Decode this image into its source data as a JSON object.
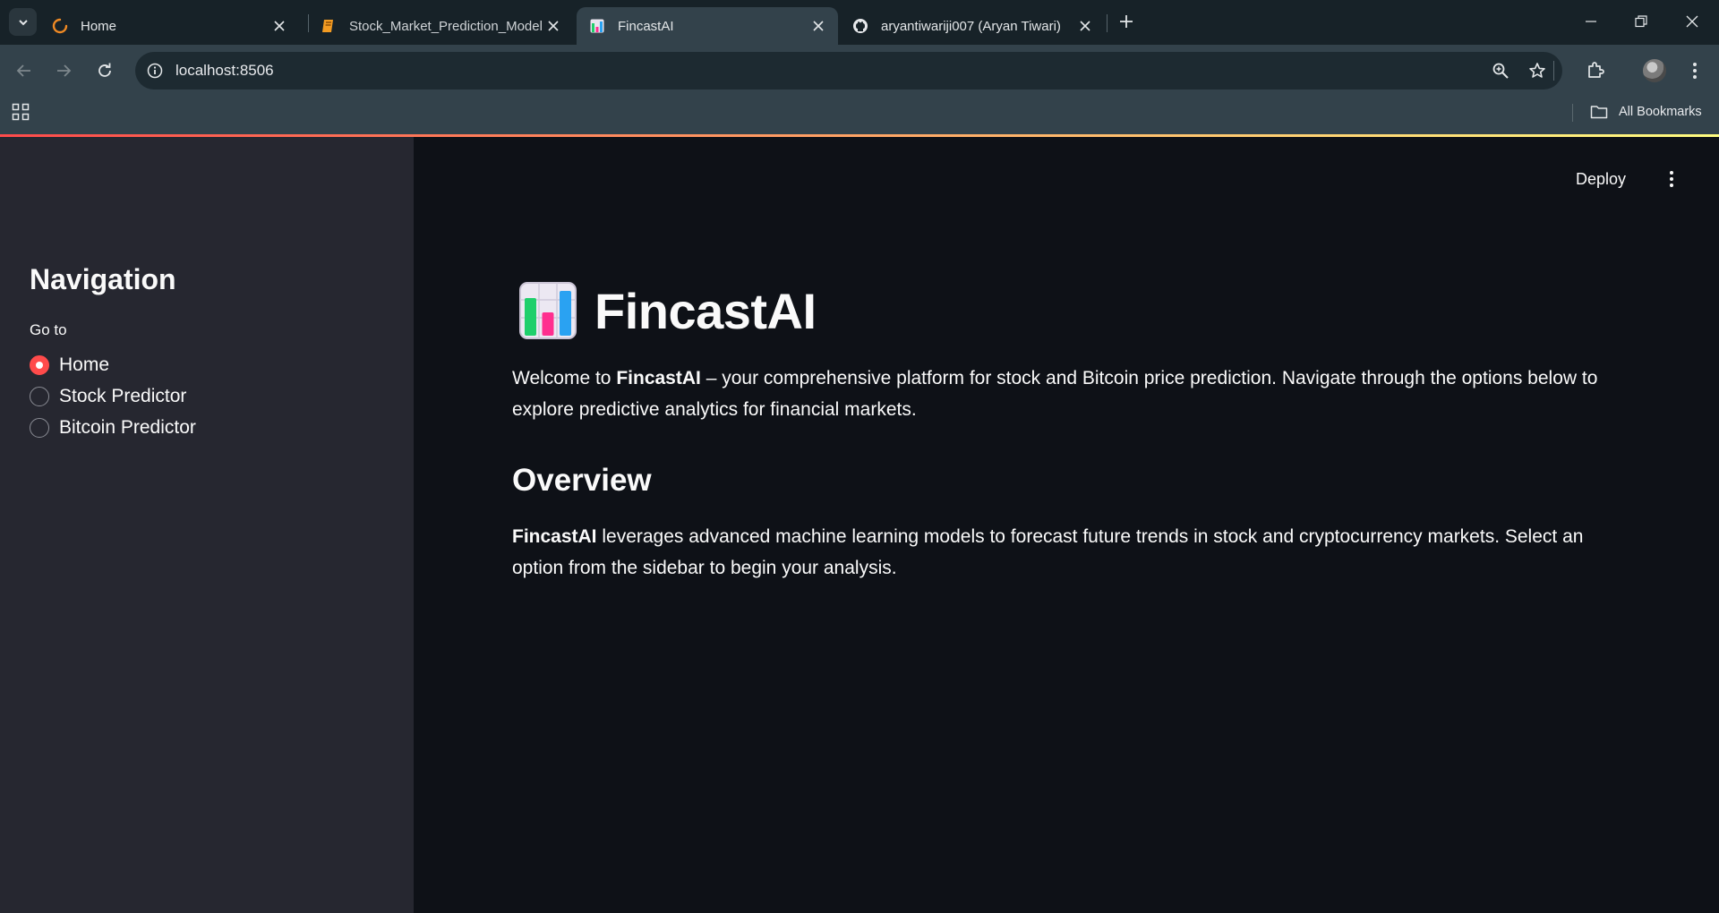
{
  "browser": {
    "tabs": [
      {
        "title": "Home",
        "favicon": "loading-spinner-icon",
        "active": false
      },
      {
        "title": "Stock_Market_Prediction_Model",
        "favicon": "book-icon",
        "active": false
      },
      {
        "title": "FincastAI",
        "favicon": "bar-chart-icon",
        "active": true
      },
      {
        "title": "aryantiwariji007 (Aryan Tiwari)",
        "favicon": "github-icon",
        "active": false
      }
    ],
    "url": "localhost:8506",
    "bookmarks_label": "All Bookmarks"
  },
  "sidebar": {
    "title": "Navigation",
    "radio_label": "Go to",
    "options": [
      {
        "label": "Home",
        "checked": true
      },
      {
        "label": "Stock Predictor",
        "checked": false
      },
      {
        "label": "Bitcoin Predictor",
        "checked": false
      }
    ]
  },
  "main": {
    "deploy_label": "Deploy",
    "title": "FincastAI",
    "intro_prefix": "Welcome to ",
    "intro_bold": "FincastAI",
    "intro_suffix": " – your comprehensive platform for stock and Bitcoin price prediction. Navigate through the options below to explore predictive analytics for financial markets.",
    "overview_title": "Overview",
    "overview_bold": "FincastAI",
    "overview_text": " leverages advanced machine learning models to forecast future trends in stock and cryptocurrency markets. Select an option from the sidebar to begin your analysis."
  },
  "colors": {
    "accent": "#ff4b4b",
    "app_bg": "#0e1117",
    "sidebar_bg": "#262730"
  }
}
